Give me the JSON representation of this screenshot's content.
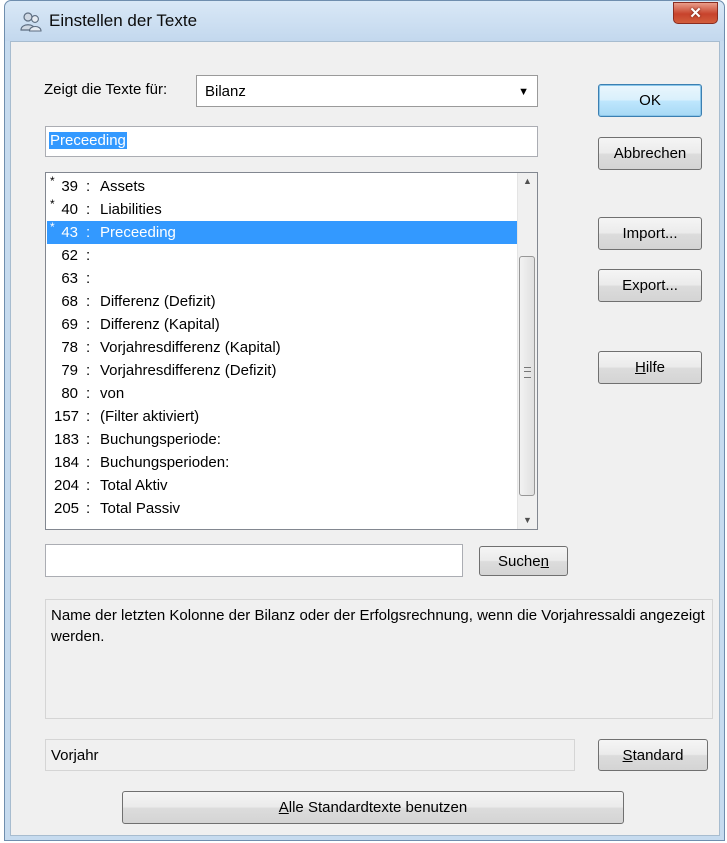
{
  "window": {
    "title": "Einstellen der Texte",
    "close_symbol": "✕"
  },
  "icons": {
    "app": "people-icon",
    "close": "close-icon",
    "combo_arrow": "dropdown-arrow-icon"
  },
  "show_for": {
    "label": "Zeigt die Texte für:",
    "selected": "Bilanz"
  },
  "text_edit": {
    "value": "Preceeding"
  },
  "buttons": {
    "ok": "OK",
    "cancel": "Abbrechen",
    "import": "Import...",
    "export": "Export...",
    "help_pre": "",
    "help_key": "H",
    "help_post": "ilfe",
    "search_pre": "Suche",
    "search_key": "n",
    "standard_key": "S",
    "standard_post": "tandard",
    "all_key": "A",
    "all_post": "lle Standardtexte benutzen"
  },
  "list": {
    "items": [
      {
        "marker": "*",
        "num": "39",
        "text": "Assets"
      },
      {
        "marker": "*",
        "num": "40",
        "text": "Liabilities"
      },
      {
        "marker": "*",
        "num": "43",
        "text": "Preceeding"
      },
      {
        "marker": "",
        "num": "62",
        "text": ""
      },
      {
        "marker": "",
        "num": "63",
        "text": ""
      },
      {
        "marker": "",
        "num": "68",
        "text": "Differenz (Defizit)"
      },
      {
        "marker": "",
        "num": "69",
        "text": "Differenz (Kapital)"
      },
      {
        "marker": "",
        "num": "78",
        "text": "Vorjahresdifferenz (Kapital)"
      },
      {
        "marker": "",
        "num": "79",
        "text": "Vorjahresdifferenz (Defizit)"
      },
      {
        "marker": "",
        "num": "80",
        "text": " von"
      },
      {
        "marker": "",
        "num": "157",
        "text": "(Filter aktiviert)"
      },
      {
        "marker": "",
        "num": "183",
        "text": "Buchungsperiode:"
      },
      {
        "marker": "",
        "num": "184",
        "text": "Buchungsperioden:"
      },
      {
        "marker": "",
        "num": "204",
        "text": "Total Aktiv"
      },
      {
        "marker": "",
        "num": "205",
        "text": "Total Passiv"
      }
    ],
    "selected_index": 2
  },
  "search": {
    "value": ""
  },
  "description": {
    "text": "Name der letzten Kolonne der Bilanz oder der Erfolgsrechnung, wenn die Vorjahressaldi angezeigt werden."
  },
  "default_text": {
    "value": "Vorjahr"
  }
}
